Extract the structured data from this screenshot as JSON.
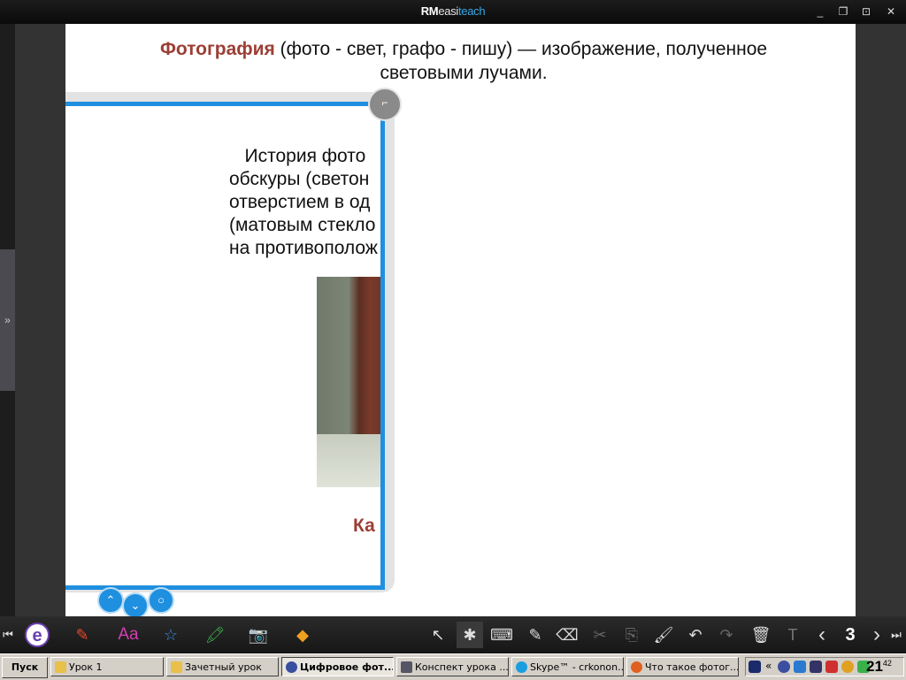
{
  "app": {
    "title_rm": "RM",
    "title_easi": "easi",
    "title_teach": "teach",
    "window_buttons": [
      "_",
      "❐",
      "⊡",
      "✕"
    ]
  },
  "side_handle": "»",
  "heading": {
    "term": "Фотография",
    "rest_line1": " (фото - свет, графо - пишу) — изображение, полученное",
    "line2": "световыми лучами."
  },
  "card": {
    "lines": [
      "   История фото",
      "обскуры (светон",
      "отверстием в од",
      "(матовым стекло",
      "на противополож"
    ],
    "caption": "Ка",
    "corner_icon": "⌐"
  },
  "card_nav": {
    "up": "⌃",
    "down": "⌄",
    "circle": "○"
  },
  "toolbar": {
    "collapse": "⏮",
    "easi_logo": "e",
    "pen": "✎",
    "text": "Aa",
    "star": "☆",
    "highlighter": "🖍",
    "camera": "📷",
    "eraser_tool": "◆",
    "select": "↖",
    "magic_select": "✱",
    "keyboard": "⌨",
    "pen2": "✎",
    "eraser": "⌫",
    "cut": "✂",
    "copy": "⎘",
    "brush": "🖌",
    "undo": "↶",
    "redo": "↷",
    "delete": "🗑",
    "text_tool": "T",
    "prev": "‹",
    "page_number": "3",
    "next": "›",
    "end": "⏭"
  },
  "taskbar": {
    "start": "Пуск",
    "tasks": [
      {
        "label": "Урок 1",
        "color": "#e8c04a"
      },
      {
        "label": "Зачетный урок",
        "color": "#e8c04a"
      },
      {
        "label": "Цифровое фот...",
        "color": "#3a4fa0",
        "active": true
      },
      {
        "label": "Конспект урока ...",
        "color": "#556"
      },
      {
        "label": "Skype™ - crkonon...",
        "color": "#1a9ee0"
      },
      {
        "label": "Что такое фотог...",
        "color": "#e06020"
      }
    ],
    "tray_clock_hour": "21",
    "tray_clock_min": "42",
    "tray_collapse": "«"
  }
}
